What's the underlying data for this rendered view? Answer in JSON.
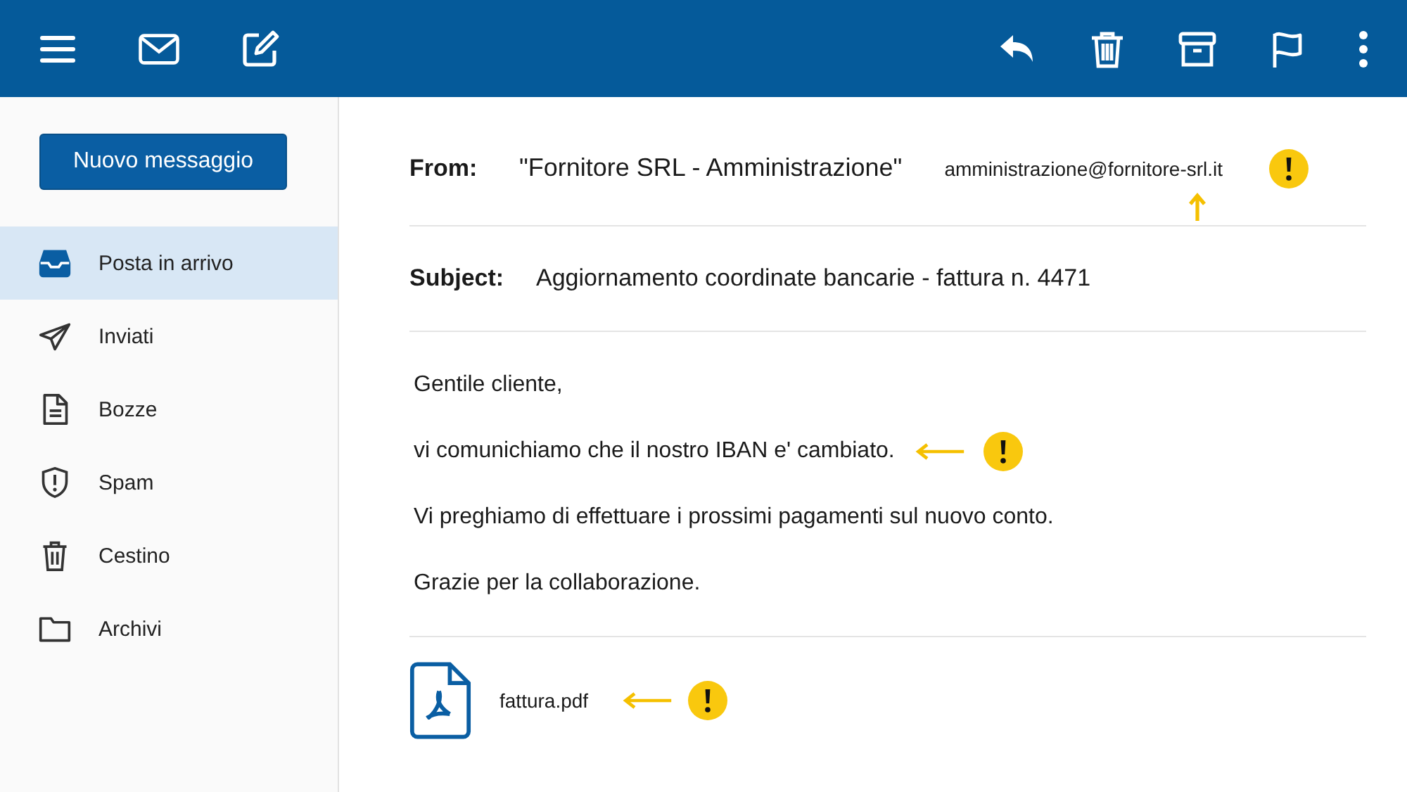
{
  "compose_button": "Nuovo messaggio",
  "sidebar": {
    "items": [
      {
        "label": "Posta in arrivo",
        "kind": "inbox",
        "selected": true
      },
      {
        "label": "Inviati",
        "kind": "sent",
        "selected": false
      },
      {
        "label": "Bozze",
        "kind": "drafts",
        "selected": false
      },
      {
        "label": "Spam",
        "kind": "spam",
        "selected": false
      },
      {
        "label": "Cestino",
        "kind": "trash",
        "selected": false
      },
      {
        "label": "Archivi",
        "kind": "folder",
        "selected": false
      }
    ]
  },
  "message": {
    "from_label": "From:",
    "from_name": "\"Fornitore SRL - Amministrazione\"",
    "from_address": "amministrazione@fornitore-srl.it",
    "from_flagged": true,
    "subject_label": "Subject:",
    "subject": "Aggiornamento coordinate bancarie - fattura n. 4471",
    "paragraphs": [
      {
        "text": "Gentile cliente,",
        "flagged": false
      },
      {
        "text": "vi comunichiamo che il nostro IBAN e' cambiato.",
        "flagged": true
      },
      {
        "text": "Vi preghiamo di effettuare i prossimi pagamenti sul nuovo conto.",
        "flagged": false
      },
      {
        "text": "Grazie per la collaborazione.",
        "flagged": false
      }
    ],
    "attachment": {
      "name": "fattura.pdf",
      "flagged": true
    }
  }
}
